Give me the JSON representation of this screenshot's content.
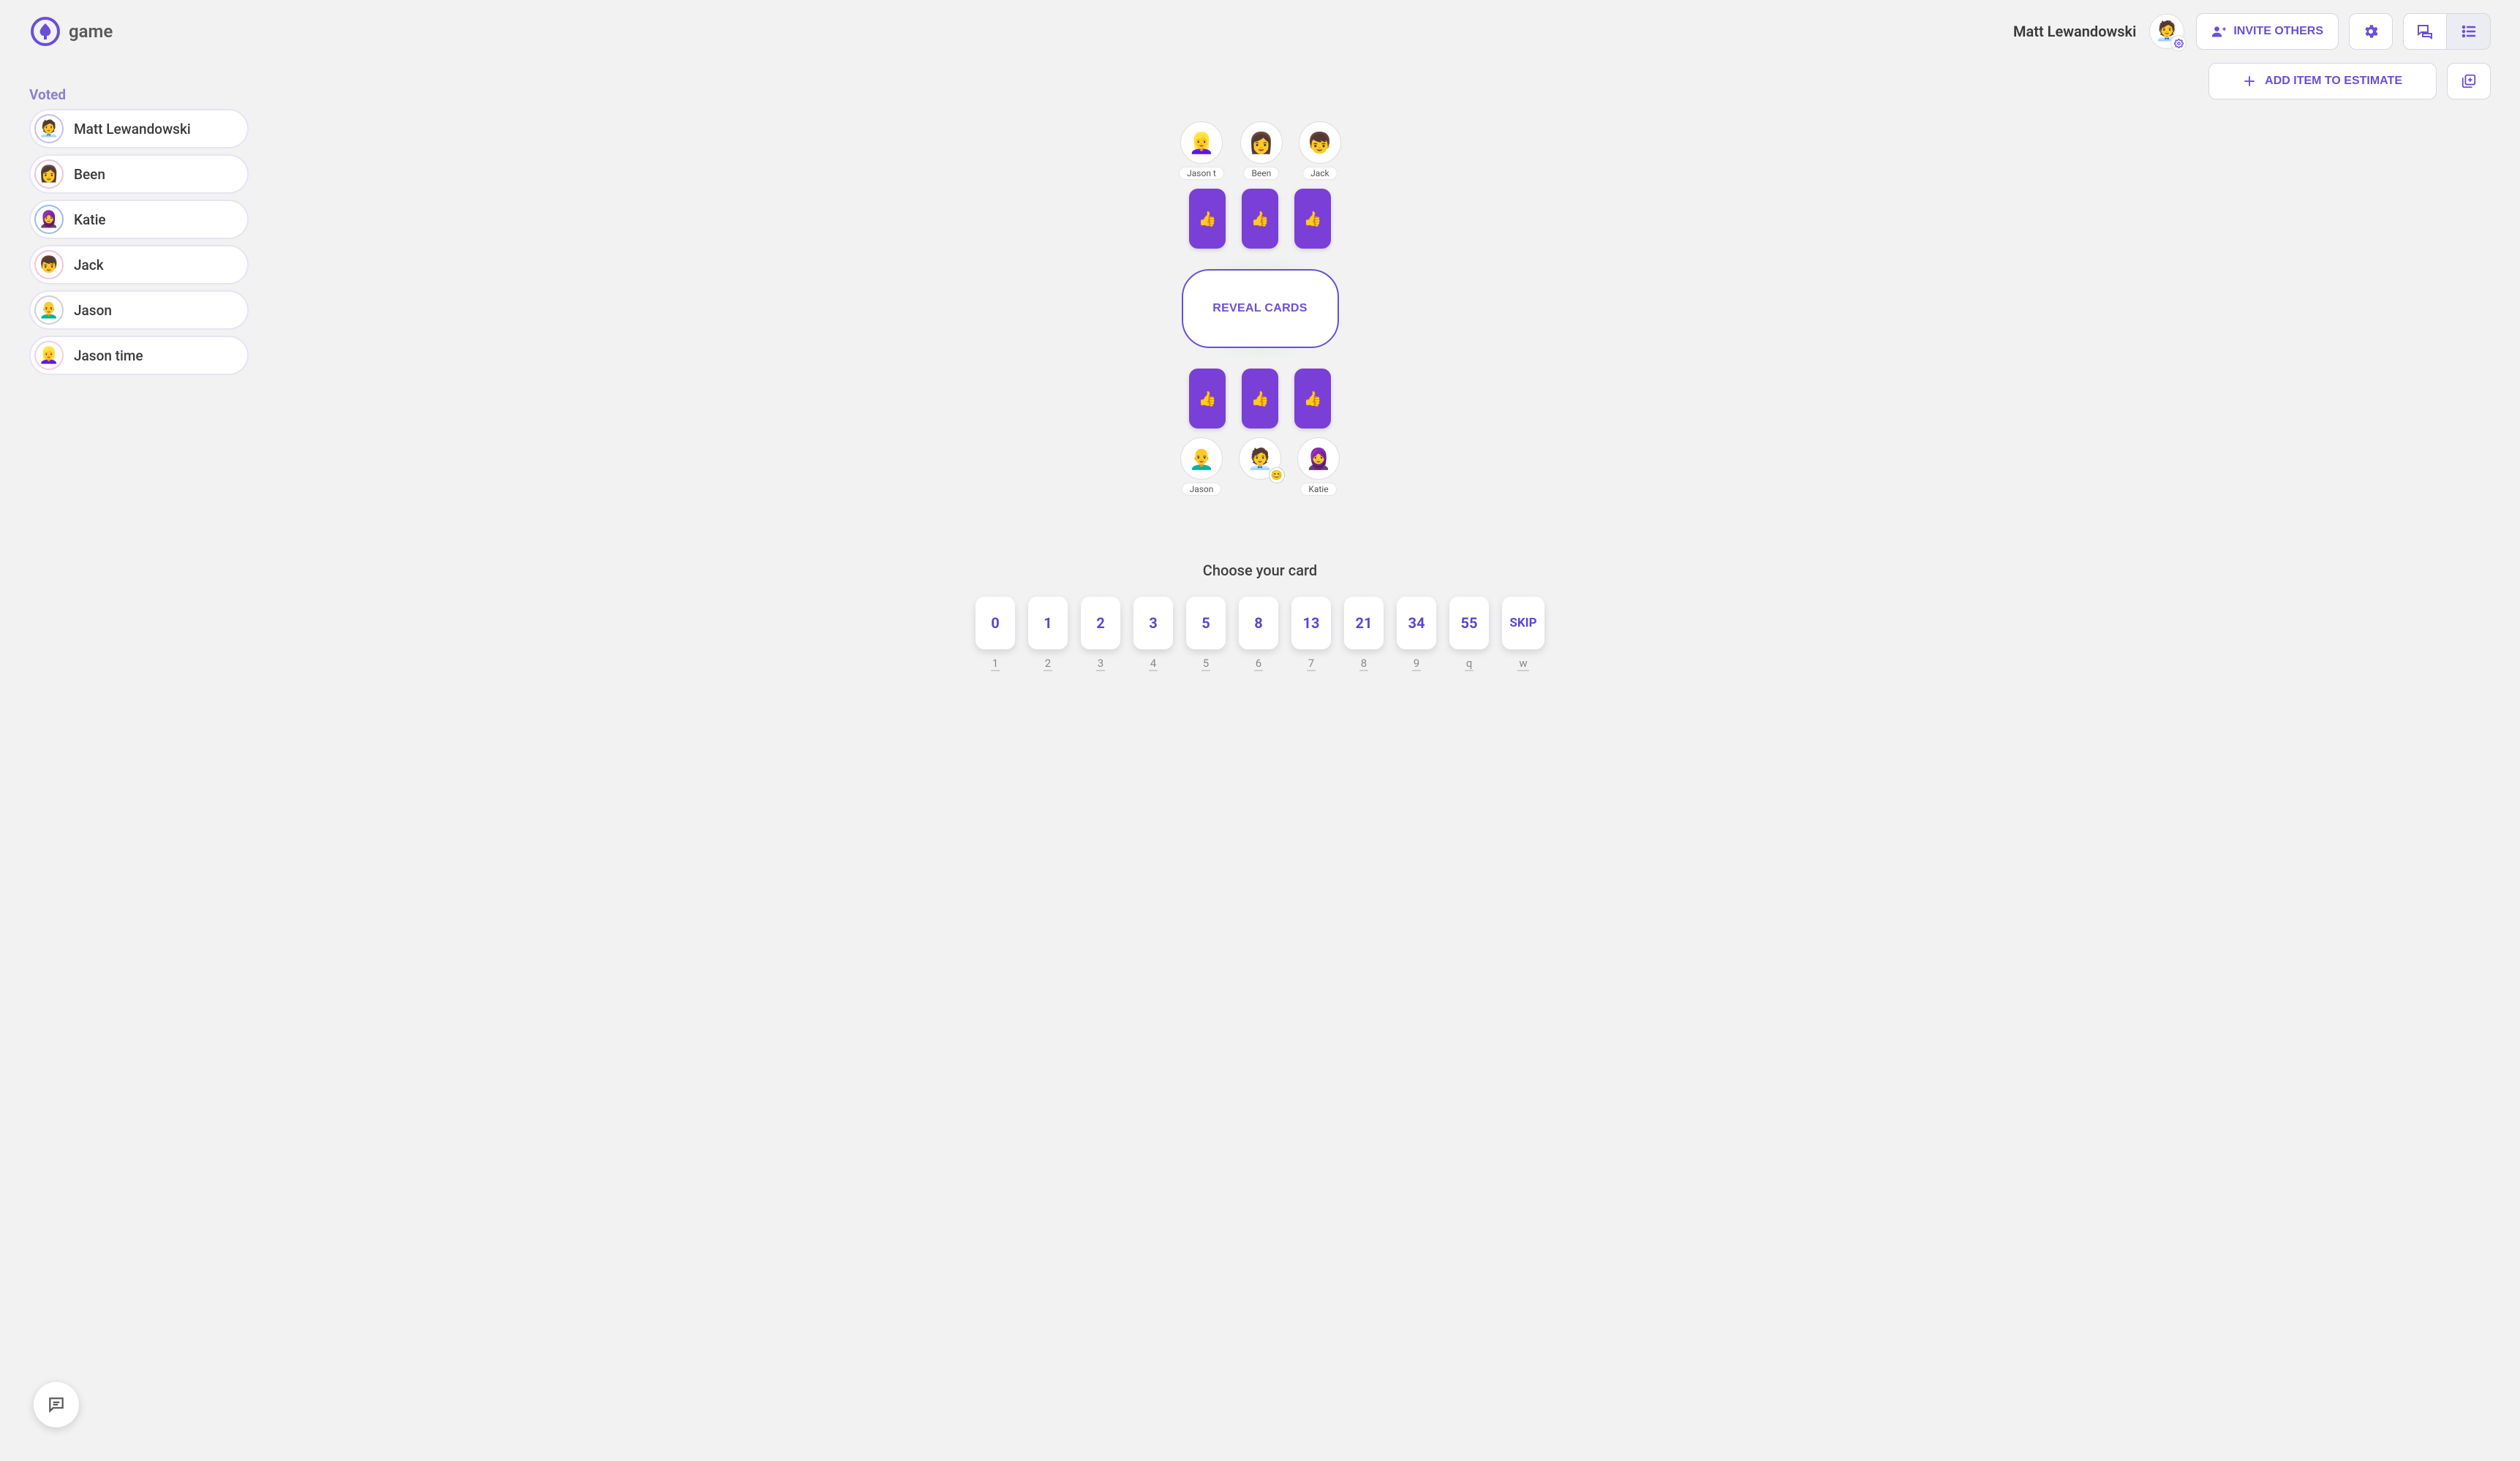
{
  "app": {
    "name": "game"
  },
  "header": {
    "user_name": "Matt Lewandowski",
    "invite_label": "INVITE OTHERS"
  },
  "toolbar": {
    "add_item_label": "ADD ITEM TO ESTIMATE"
  },
  "voted": {
    "title": "Voted",
    "players": [
      {
        "name": "Matt Lewandowski",
        "avatar": "🧑‍💼",
        "ring": "#c8bdf0"
      },
      {
        "name": "Been",
        "avatar": "👩",
        "ring": "#f1c2d8"
      },
      {
        "name": "Katie",
        "avatar": "🧕",
        "ring": "#9fb9ef"
      },
      {
        "name": "Jack",
        "avatar": "👦",
        "ring": "#f4c2d7"
      },
      {
        "name": "Jason",
        "avatar": "👨‍🦲",
        "ring": "#d0d0d0"
      },
      {
        "name": "Jason time",
        "avatar": "👱‍♀️",
        "ring": "#f3cfe0"
      }
    ]
  },
  "table": {
    "reveal_label": "REVEAL CARDS",
    "top_seats": [
      {
        "name": "Jason t",
        "avatar": "👱‍♀️"
      },
      {
        "name": "Been",
        "avatar": "👩"
      },
      {
        "name": "Jack",
        "avatar": "👦"
      }
    ],
    "bottom_seats": [
      {
        "name": "Jason",
        "avatar": "👨‍🦲"
      },
      {
        "name": "",
        "avatar": "🧑‍💼",
        "badge": true
      },
      {
        "name": "Katie",
        "avatar": "🧕"
      }
    ],
    "card_icon": "👍"
  },
  "deck": {
    "title": "Choose your card",
    "cards": [
      {
        "label": "0",
        "hotkey": "1"
      },
      {
        "label": "1",
        "hotkey": "2"
      },
      {
        "label": "2",
        "hotkey": "3"
      },
      {
        "label": "3",
        "hotkey": "4"
      },
      {
        "label": "5",
        "hotkey": "5"
      },
      {
        "label": "8",
        "hotkey": "6"
      },
      {
        "label": "13",
        "hotkey": "7"
      },
      {
        "label": "21",
        "hotkey": "8"
      },
      {
        "label": "34",
        "hotkey": "9"
      },
      {
        "label": "55",
        "hotkey": "q"
      },
      {
        "label": "SKIP",
        "hotkey": "w"
      }
    ]
  },
  "colors": {
    "accent": "#6b4fd6",
    "card_purple": "#7a3fd6"
  }
}
